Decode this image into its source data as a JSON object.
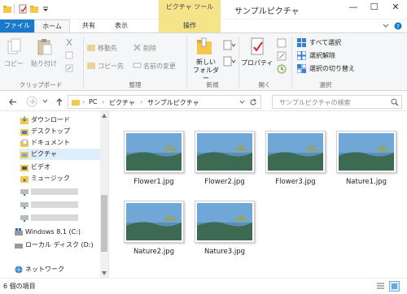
{
  "titlebar": {
    "title": "サンプルピクチャ",
    "context_tab_group": "ピクチャ ツール",
    "minimize": "—",
    "maximize": "☐",
    "close": "✕"
  },
  "ribbon_tabs": {
    "file": "ファイル",
    "home": "ホーム",
    "share": "共有",
    "view": "表示",
    "manage": "操作"
  },
  "ribbon": {
    "clipboard": {
      "copy": "コピー",
      "paste": "貼り付け",
      "group": "クリップボード"
    },
    "organize": {
      "move_to": "移動先",
      "copy_to": "コピー先",
      "delete": "削除",
      "rename": "名前の変更",
      "group": "整理"
    },
    "new": {
      "new_folder": "新しい\nフォルダー",
      "group": "新規"
    },
    "open": {
      "properties": "プロパティ",
      "group": "開く"
    },
    "select": {
      "select_all": "すべて選択",
      "select_none": "選択解除",
      "invert": "選択の切り替え",
      "group": "選択"
    }
  },
  "address": {
    "crumbs": [
      "PC",
      "ピクチャ",
      "サンプルピクチャ"
    ],
    "search_placeholder": "サンプルピクチャの検索"
  },
  "nav": {
    "items": [
      {
        "label": "ダウンロード",
        "icon": "download-icon"
      },
      {
        "label": "デスクトップ",
        "icon": "desktop-icon"
      },
      {
        "label": "ドキュメント",
        "icon": "documents-icon"
      },
      {
        "label": "ピクチャ",
        "icon": "pictures-icon"
      },
      {
        "label": "ビデオ",
        "icon": "videos-icon"
      },
      {
        "label": "ミュージック",
        "icon": "music-icon"
      },
      {
        "label": "",
        "icon": "network-drive-icon"
      },
      {
        "label": "",
        "icon": "network-drive-icon"
      },
      {
        "label": "",
        "icon": "network-drive-icon"
      },
      {
        "label": "Windows 8.1 (C:)",
        "icon": "windows-drive-icon"
      },
      {
        "label": "ローカル ディスク (D:)",
        "icon": "drive-icon"
      },
      {
        "label": "ネットワーク",
        "icon": "network-icon"
      }
    ]
  },
  "files": [
    {
      "name": "Flower1.jpg"
    },
    {
      "name": "Flower2.jpg"
    },
    {
      "name": "Flower3.jpg"
    },
    {
      "name": "Nature1.jpg"
    },
    {
      "name": "Nature2.jpg"
    },
    {
      "name": "Nature3.jpg"
    }
  ],
  "status": {
    "count": "6 個の項目"
  },
  "colors": {
    "accent": "#1979ca",
    "context_tab": "#f5e48a",
    "selection": "#dfeefc"
  }
}
